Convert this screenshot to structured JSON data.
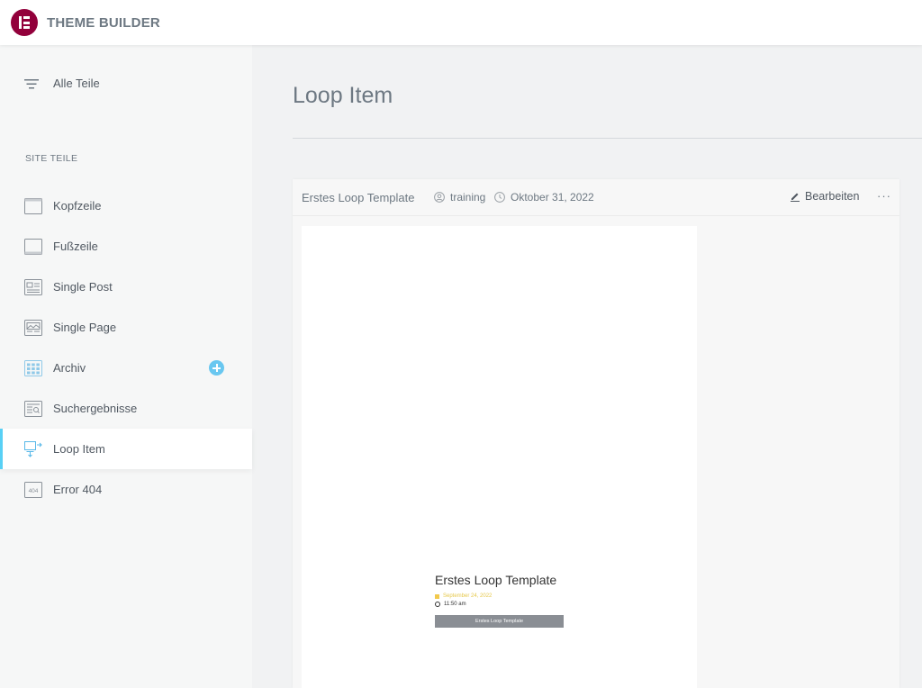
{
  "app": {
    "title": "THEME BUILDER"
  },
  "sidebar": {
    "all_label": "Alle Teile",
    "section_title": "SITE TEILE",
    "items": [
      {
        "label": "Kopfzeile",
        "icon": "header-icon"
      },
      {
        "label": "Fußzeile",
        "icon": "footer-icon"
      },
      {
        "label": "Single Post",
        "icon": "single-post-icon"
      },
      {
        "label": "Single Page",
        "icon": "single-page-icon"
      },
      {
        "label": "Archiv",
        "icon": "archive-icon",
        "has_add": true
      },
      {
        "label": "Suchergebnisse",
        "icon": "search-results-icon"
      },
      {
        "label": "Loop Item",
        "icon": "loop-item-icon",
        "active": true
      },
      {
        "label": "Error 404",
        "icon": "error-404-icon",
        "badge": "404"
      }
    ]
  },
  "main": {
    "title": "Loop Item",
    "card": {
      "title": "Erstes Loop Template",
      "author": "training",
      "date": "Oktober 31, 2022",
      "edit_label": "Bearbeiten",
      "more_label": "···",
      "preview": {
        "title": "Erstes Loop Template",
        "date": "September 24, 2022",
        "time": "11:50 am",
        "button": "Erstes Loop Template"
      }
    }
  },
  "colors": {
    "brand": "#92003b",
    "accent": "#58d0f5",
    "add_button": "#69c7f0",
    "preview_date": "#f2c94c"
  }
}
